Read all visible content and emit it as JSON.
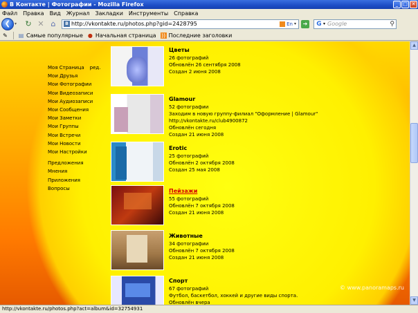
{
  "window": {
    "title": "В Контакте | Фотографии - Mozilla Firefox"
  },
  "menu": [
    "Файл",
    "Правка",
    "Вид",
    "Журнал",
    "Закладки",
    "Инструменты",
    "Справка"
  ],
  "nav": {
    "url": "http://vkontakte.ru/photos.php?gid=2428795",
    "lang": "En",
    "search_placeholder": "Google"
  },
  "bookmarks": [
    "Самые популярные",
    "Начальная страница",
    "Последние заголовки"
  ],
  "sidebar": {
    "edit_label": "ред.",
    "items": [
      "Моя Страница",
      "Мои Друзья",
      "Мои Фотографии",
      "Мои Видеозаписи",
      "Мои Аудиозаписи",
      "Мои Сообщения",
      "Мои Заметки",
      "Мои Группы",
      "Мои Встречи",
      "Мои Новости",
      "Мои Настройки"
    ],
    "extra": [
      "Предложения",
      "Мнения",
      "Приложения",
      "Вопросы"
    ]
  },
  "albums": [
    {
      "name": "Цветы",
      "lines": [
        "26 фотографий",
        "Обновлён 26 сентября 2008",
        "Создан 2 июня 2008"
      ]
    },
    {
      "name": "Glamour",
      "lines": [
        "52 фотографии",
        "Заходим в новую группу-филиал \"Оформление | Glamour\"",
        "http://vkontakte.ru/club4900872",
        "Обновлён сегодня",
        "Создан 21 июня 2008"
      ]
    },
    {
      "name": "Erotic",
      "lines": [
        "25 фотографий",
        "Обновлён 2 октября 2008",
        "Создан 25 мая 2008"
      ]
    },
    {
      "name": "Пейзажи",
      "lines": [
        "55 фотографий",
        "Обновлён 7 октября 2008",
        "Создан 21 июня 2008"
      ],
      "highlight": true
    },
    {
      "name": "Животные",
      "lines": [
        "34 фотографии",
        "Обновлён 7 октября 2008",
        "Создан 21 июня 2008"
      ]
    },
    {
      "name": "Спорт",
      "lines": [
        "67 фотографий",
        "Футбол, баскетбол, хоккей и другие виды спорта.",
        "Обновлён вчера"
      ]
    }
  ],
  "watermark": "© www.panoramaps.ru",
  "status": "http://vkontakte.ru/photos.php?act=album&id=32754931"
}
